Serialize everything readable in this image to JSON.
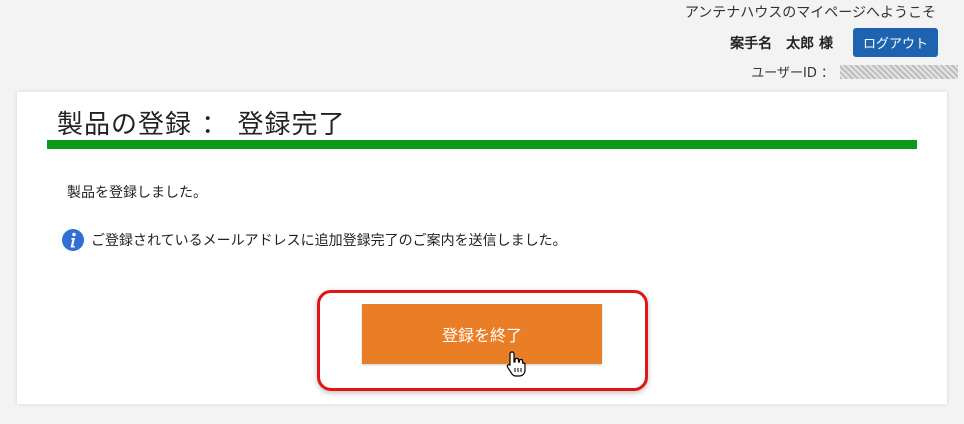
{
  "header": {
    "welcome": "アンテナハウスのマイページへようこそ",
    "user_name": "案手名　太郎 様",
    "logout_label": "ログアウト",
    "user_id_label": "ユーザーID ："
  },
  "main": {
    "title": "製品の登録 ： 登録完了",
    "message": "製品を登録しました。",
    "info_message": "ご登録されているメールアドレスに追加登録完了のご案内を送信しました。",
    "finish_button_label": "登録を終了"
  },
  "colors": {
    "accent_green": "#0b9a1a",
    "button_orange": "#ea7e26",
    "logout_blue": "#1e63b0",
    "highlight_red": "#e01515",
    "info_blue": "#2f6fd6"
  },
  "icons": {
    "info": "info-icon",
    "cursor": "hand-pointer-icon"
  }
}
